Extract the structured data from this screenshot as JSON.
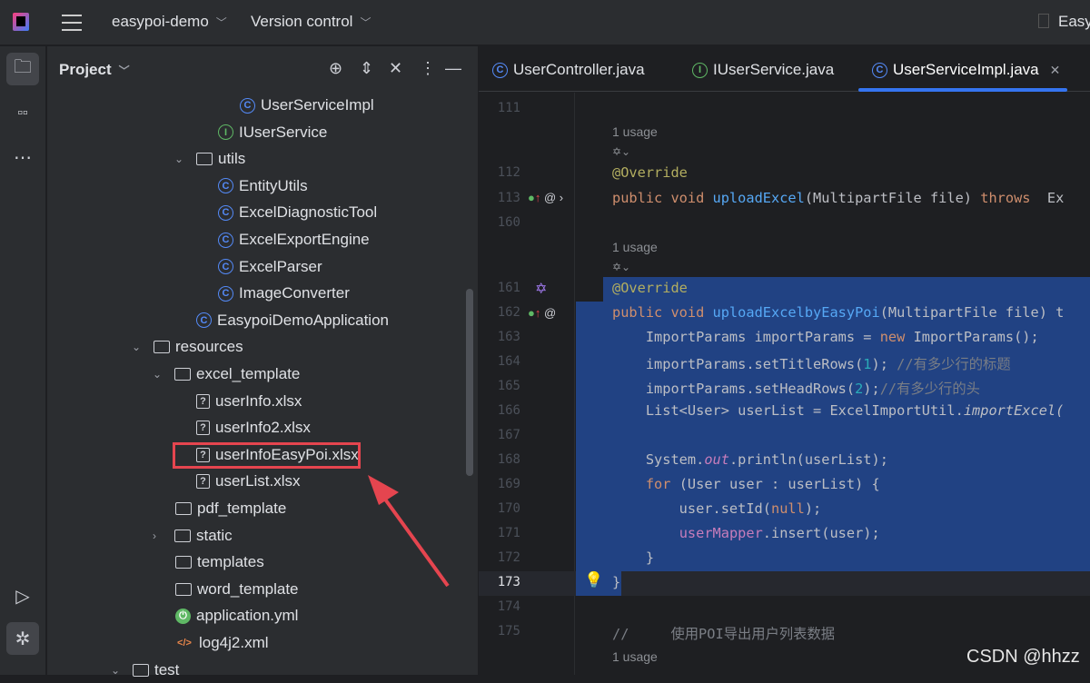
{
  "topbar": {
    "project": "easypoi-demo",
    "vcs": "Version control",
    "run_config": "Easy"
  },
  "panel": {
    "title": "Project"
  },
  "tree": [
    {
      "label": "UserServiceImpl",
      "icon": "class"
    },
    {
      "label": "IUserService",
      "icon": "interface"
    },
    {
      "label": "utils",
      "icon": "folder",
      "expanded": true
    },
    {
      "label": "EntityUtils",
      "icon": "class"
    },
    {
      "label": "ExcelDiagnosticTool",
      "icon": "class"
    },
    {
      "label": "ExcelExportEngine",
      "icon": "class"
    },
    {
      "label": "ExcelParser",
      "icon": "class"
    },
    {
      "label": "ImageConverter",
      "icon": "class"
    },
    {
      "label": "EasypoiDemoApplication",
      "icon": "class"
    },
    {
      "label": "resources",
      "icon": "folder",
      "expanded": true
    },
    {
      "label": "excel_template",
      "icon": "folder",
      "expanded": true
    },
    {
      "label": "userInfo.xlsx",
      "icon": "file"
    },
    {
      "label": "userInfo2.xlsx",
      "icon": "file"
    },
    {
      "label": "userInfoEasyPoi.xlsx",
      "icon": "file",
      "highlighted": true
    },
    {
      "label": "userList.xlsx",
      "icon": "file"
    },
    {
      "label": "pdf_template",
      "icon": "folder"
    },
    {
      "label": "static",
      "icon": "folder",
      "expanded": false
    },
    {
      "label": "templates",
      "icon": "folder"
    },
    {
      "label": "word_template",
      "icon": "folder"
    },
    {
      "label": "application.yml",
      "icon": "yml"
    },
    {
      "label": "log4j2.xml",
      "icon": "xml"
    },
    {
      "label": "test",
      "icon": "folder",
      "expanded": true
    }
  ],
  "tabs": [
    {
      "label": "UserController.java",
      "icon": "C"
    },
    {
      "label": "IUserService.java",
      "icon": "I"
    },
    {
      "label": "UserServiceImpl.java",
      "icon": "C",
      "active": true
    }
  ],
  "hints": {
    "usage": "1 usage"
  },
  "lines": [
    {
      "n": "111",
      "t": []
    },
    {
      "n": "112",
      "t": [
        [
          "@Override",
          "an"
        ]
      ]
    },
    {
      "n": "113",
      "t": [
        [
          "public void ",
          "kw"
        ],
        [
          "uploadExcel",
          "fn"
        ],
        [
          "(MultipartFile file) ",
          ""
        ],
        [
          "throws",
          "kw"
        ],
        [
          "  Ex",
          ""
        ]
      ]
    },
    {
      "n": "160",
      "t": []
    },
    {
      "n": "161",
      "t": [
        [
          "@Override",
          "an"
        ]
      ]
    },
    {
      "n": "162",
      "t": [
        [
          "public void ",
          "kw"
        ],
        [
          "uploadExcelbyEasyPoi",
          "fn"
        ],
        [
          "(MultipartFile file) t",
          ""
        ]
      ]
    },
    {
      "n": "163",
      "t": [
        [
          "    ImportParams importParams = ",
          ""
        ],
        [
          "new",
          "kw"
        ],
        [
          " ImportParams();",
          ""
        ]
      ]
    },
    {
      "n": "164",
      "t": [
        [
          "    importParams.setTitleRows(",
          ""
        ],
        [
          "1",
          "num"
        ],
        [
          "); ",
          ""
        ],
        [
          "//有多少行的标题",
          "cm"
        ]
      ]
    },
    {
      "n": "165",
      "t": [
        [
          "    importParams.setHeadRows(",
          ""
        ],
        [
          "2",
          "num"
        ],
        [
          ");",
          ""
        ],
        [
          "//有多少行的头",
          "cm"
        ]
      ]
    },
    {
      "n": "166",
      "t": [
        [
          "    List<User> userList = ExcelImportUtil.",
          ""
        ],
        [
          "importExcel(",
          "it"
        ]
      ]
    },
    {
      "n": "167",
      "t": []
    },
    {
      "n": "168",
      "t": [
        [
          "    System.",
          ""
        ],
        [
          "out",
          "fld it"
        ],
        [
          ".println(userList);",
          ""
        ]
      ]
    },
    {
      "n": "169",
      "t": [
        [
          "    ",
          ""
        ],
        [
          "for",
          "kw"
        ],
        [
          " (User user : userList) {",
          ""
        ]
      ]
    },
    {
      "n": "170",
      "t": [
        [
          "        user.setId(",
          ""
        ],
        [
          "null",
          "kw"
        ],
        [
          ");",
          ""
        ]
      ]
    },
    {
      "n": "171",
      "t": [
        [
          "        ",
          ""
        ],
        [
          "userMapper",
          "fld"
        ],
        [
          ".insert(user);",
          ""
        ]
      ]
    },
    {
      "n": "172",
      "t": [
        [
          "    }",
          ""
        ]
      ]
    },
    {
      "n": "173",
      "t": [
        [
          "}",
          ""
        ]
      ]
    },
    {
      "n": "174",
      "t": []
    },
    {
      "n": "175",
      "t": [
        [
          "//     使用POI导出用户列表数据",
          "cm"
        ]
      ]
    }
  ],
  "watermark": "CSDN @hhzz"
}
